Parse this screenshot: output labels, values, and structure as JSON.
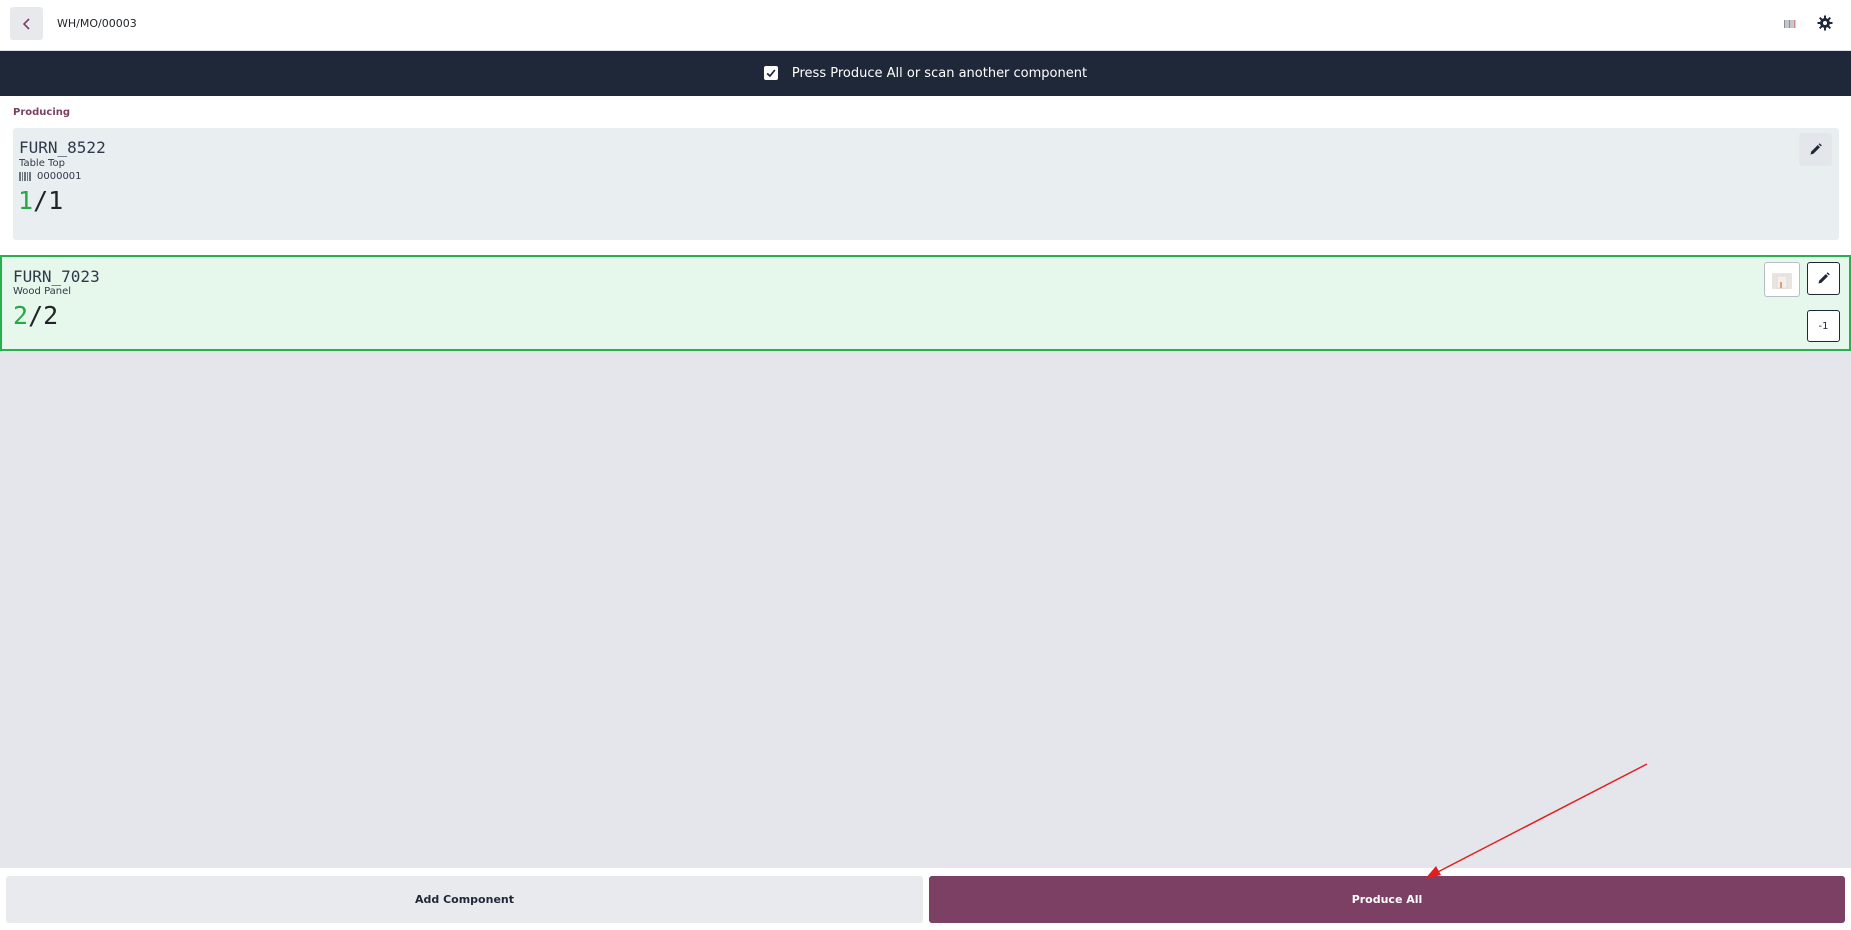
{
  "header": {
    "title": "WH/MO/00003",
    "back_icon": "chevron-left-icon",
    "barcode_icon": "barcode-icon",
    "settings_icon": "gear-icon"
  },
  "banner": {
    "message": "Press Produce All or scan another component",
    "icon": "checkbox-checked-icon"
  },
  "producing": {
    "label": "Producing",
    "card": {
      "code": "FURN_8522",
      "name": "Table Top",
      "lot": "0000001",
      "qty_done": "1",
      "qty_total": "/1"
    }
  },
  "components": [
    {
      "code": "FURN_7023",
      "name": "Wood Panel",
      "qty_done": "2",
      "qty_total": "/2",
      "decrement_label": "-1"
    }
  ],
  "footer": {
    "add_component_label": "Add Component",
    "produce_all_label": "Produce All"
  },
  "colors": {
    "accent": "#7c4064",
    "banner": "#1f2838",
    "success": "#28a745",
    "annotation_arrow": "#e02020"
  }
}
